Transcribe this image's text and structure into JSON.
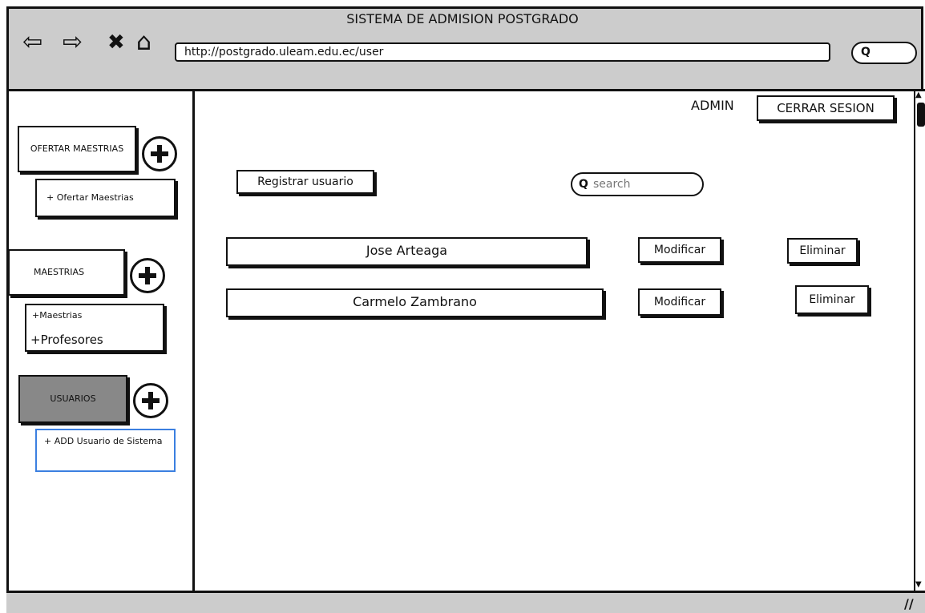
{
  "window": {
    "title": "SISTEMA DE ADMISION POSTGRADO"
  },
  "browser": {
    "back_icon": "back-arrow-icon",
    "forward_icon": "forward-arrow-icon",
    "stop_icon": "close-icon",
    "home_icon": "home-icon",
    "url": "http://postgrado.uleam.edu.ec/user"
  },
  "header": {
    "user_label": "ADMIN",
    "logout_label": "CERRAR SESION"
  },
  "sidebar": {
    "sections": [
      {
        "label": "OFERTAR MAESTRIAS",
        "items": [
          "+ Ofertar Maestrias"
        ]
      },
      {
        "label": "MAESTRIAS",
        "items": [
          "+Maestrias",
          "+Profesores"
        ]
      },
      {
        "label": "USUARIOS",
        "items": [
          "+ ADD Usuario de Sistema"
        ]
      }
    ]
  },
  "main": {
    "register_button": "Registrar usuario",
    "search_placeholder": "search",
    "users": [
      {
        "name": "Jose Arteaga",
        "modify": "Modificar",
        "delete": "Eliminar"
      },
      {
        "name": "Carmelo Zambrano",
        "modify": "Modificar",
        "delete": "Eliminar"
      }
    ]
  },
  "colors": {
    "selected_section": "#888888",
    "focus_border": "#3b7fe0",
    "chrome": "#cccccc"
  }
}
